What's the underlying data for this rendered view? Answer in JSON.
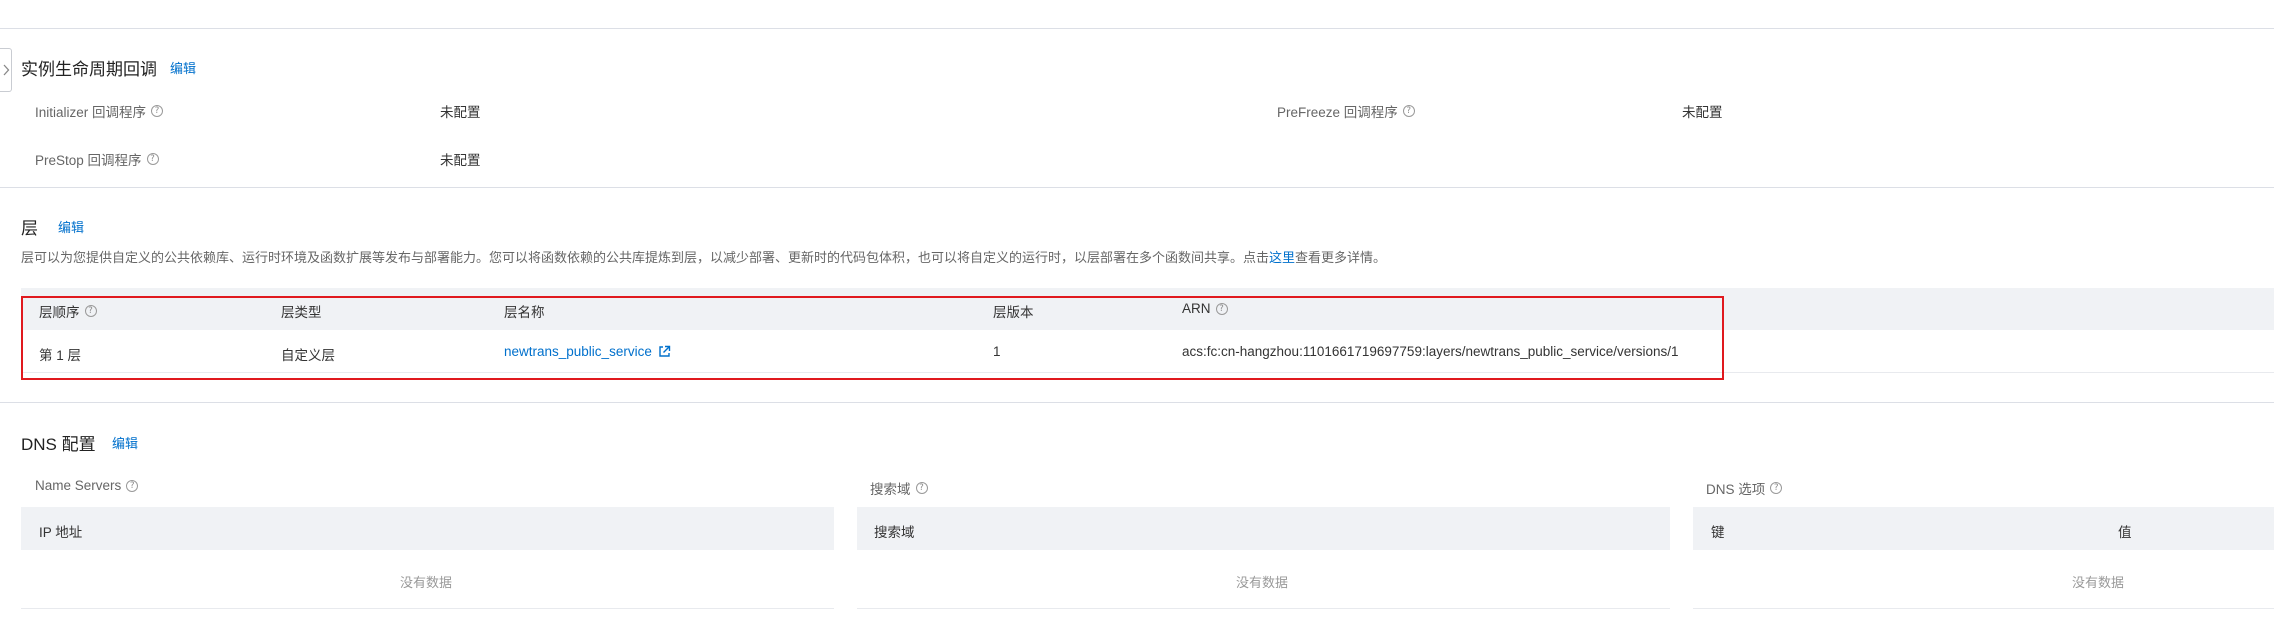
{
  "lifecycle": {
    "title": "实例生命周期回调",
    "edit_label": "编辑",
    "items": [
      {
        "label": "Initializer 回调程序",
        "value": "未配置"
      },
      {
        "label": "PreFreeze 回调程序",
        "value": "未配置"
      },
      {
        "label": "PreStop 回调程序",
        "value": "未配置"
      }
    ]
  },
  "layers": {
    "title": "层",
    "edit_label": "编辑",
    "description_before": "层可以为您提供自定义的公共依赖库、运行时环境及函数扩展等发布与部署能力。您可以将函数依赖的公共库提炼到层，以减少部署、更新时的代码包体积，也可以将自定义的运行时，以层部署在多个函数间共享。点击",
    "description_link": "这里",
    "description_after": "查看更多详情。",
    "columns": [
      "层顺序",
      "层类型",
      "层名称",
      "层版本",
      "ARN"
    ],
    "rows": [
      {
        "order": "第 1 层",
        "type": "自定义层",
        "name": "newtrans_public_service",
        "version": "1",
        "arn": "acs:fc:cn-hangzhou:1101661719697759:layers/newtrans_public_service/versions/1"
      }
    ],
    "highlight_color": "#e0191e"
  },
  "dns": {
    "title": "DNS 配置",
    "edit_label": "编辑",
    "name_servers": {
      "label": "Name Servers",
      "column": "IP 地址",
      "empty": "没有数据"
    },
    "search_domains": {
      "label": "搜索域",
      "column": "搜索域",
      "empty": "没有数据"
    },
    "dns_options": {
      "label": "DNS 选项",
      "columns": [
        "键",
        "值"
      ],
      "empty": "没有数据"
    }
  },
  "colors": {
    "link": "#0070cc",
    "header_bg": "#f0f2f5",
    "divider": "#dcdfe6"
  },
  "icons": [
    "chevron-right-icon",
    "help-icon",
    "external-link-icon"
  ]
}
